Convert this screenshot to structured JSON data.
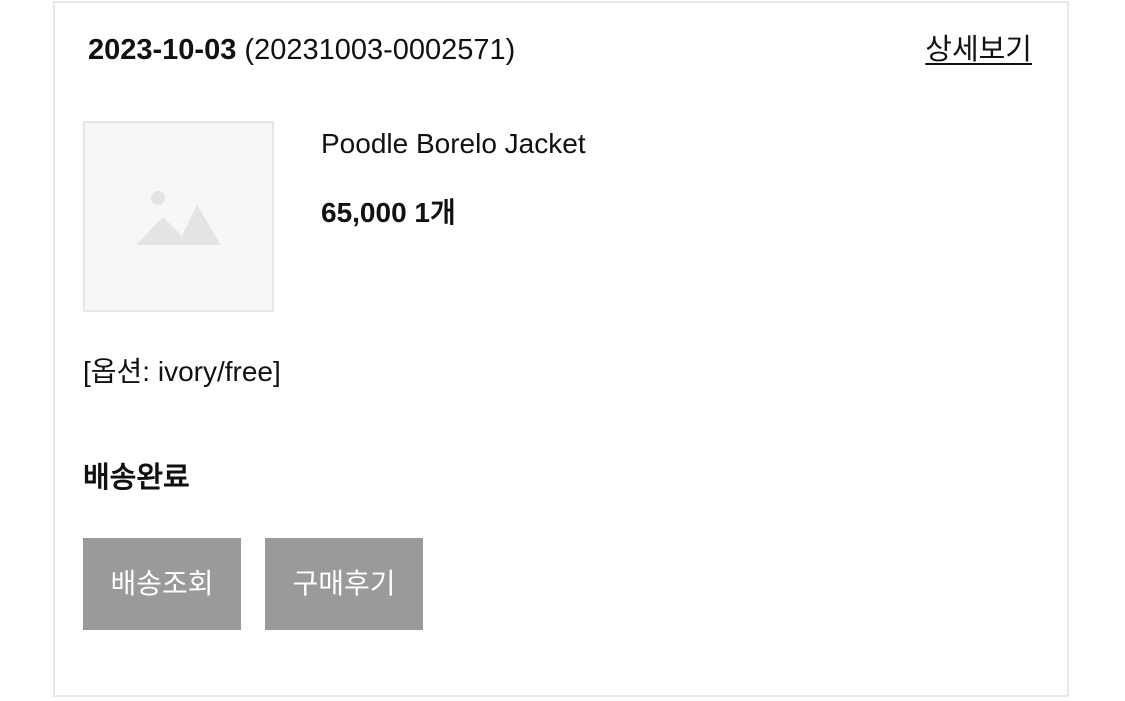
{
  "order": {
    "date": "2023-10-03",
    "number": "(20231003-0002571)",
    "detail_link": "상세보기"
  },
  "product": {
    "image_icon": "image-placeholder-icon",
    "name": "Poodle Borelo Jacket",
    "price_qty": "65,000 1개",
    "option": "[옵션: ivory/free]"
  },
  "status": {
    "label": "배송완료"
  },
  "actions": {
    "track_label": "배송조회",
    "review_label": "구매후기"
  },
  "colors": {
    "button_bg": "#9a9a9a",
    "button_text": "#ffffff",
    "card_border": "#e8e8e8",
    "placeholder_icon": "#e4e4e4"
  }
}
